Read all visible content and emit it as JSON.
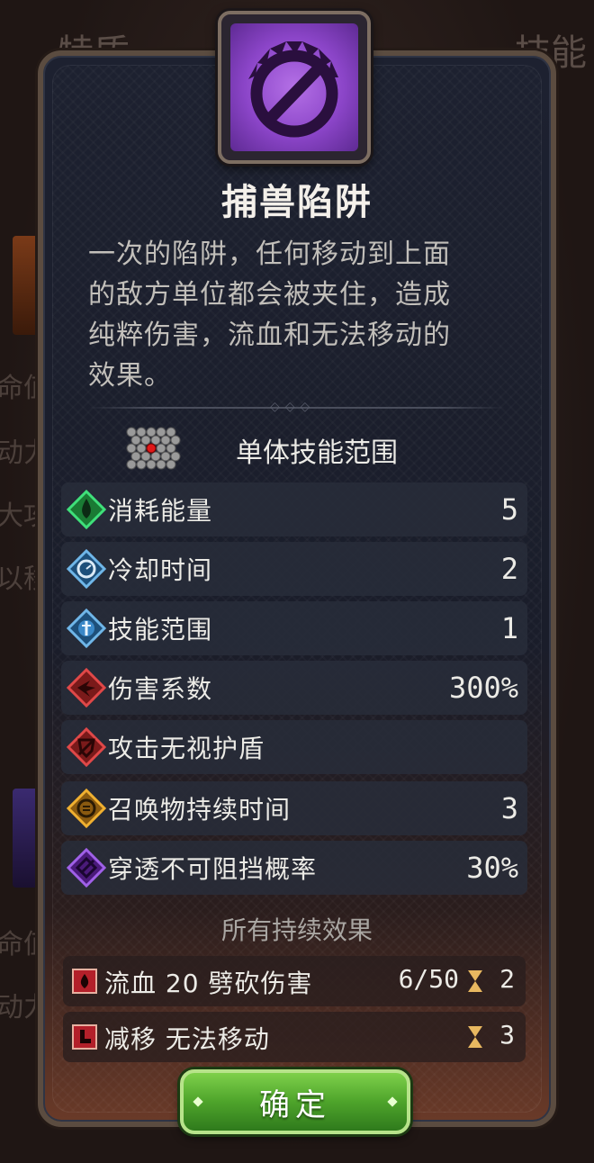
{
  "background": {
    "tab_left": "特质",
    "tab_right": "技能",
    "side_items": [
      "命值",
      "动力",
      "大攻",
      "以移",
      "命值",
      "动力"
    ]
  },
  "skill": {
    "icon": "trap-ban-icon",
    "name": "捕兽陷阱",
    "description": [
      "一次的陷阱，任何移动到上面",
      "的敌方单位都会被夹住，造成",
      "纯粹伤害，流血和无法移动的",
      "效果。"
    ],
    "range_type": "单体技能范围"
  },
  "stats": [
    {
      "icon": "energy-icon",
      "label": "消耗能量",
      "value": "5",
      "color": "#22b04a"
    },
    {
      "icon": "cooldown-icon",
      "label": "冷却时间",
      "value": "2",
      "color": "#3a8fd0"
    },
    {
      "icon": "range-icon",
      "label": "技能范围",
      "value": "1",
      "color": "#3a8fd0"
    },
    {
      "icon": "damage-coefficient-icon",
      "label": "伤害系数",
      "value": "300%",
      "color": "#c82a2a"
    },
    {
      "icon": "ignore-shield-icon",
      "label": "攻击无视护盾",
      "value": "",
      "color": "#c82a2a"
    },
    {
      "icon": "summon-duration-icon",
      "label": "召唤物持续时间",
      "value": "3",
      "color": "#e0a020"
    },
    {
      "icon": "pierce-icon",
      "label": "穿透不可阻挡概率",
      "value": "30%",
      "color": "#8a3ad0"
    }
  ],
  "effects_title": "所有持续效果",
  "effects": [
    {
      "icon": "bleed-icon",
      "label": "流血 20 劈砍伤害",
      "stack": "6/50",
      "duration": "2"
    },
    {
      "icon": "slow-icon",
      "label": "减移 无法移动",
      "stack": "",
      "duration": "3"
    }
  ],
  "confirm_label": "确定"
}
